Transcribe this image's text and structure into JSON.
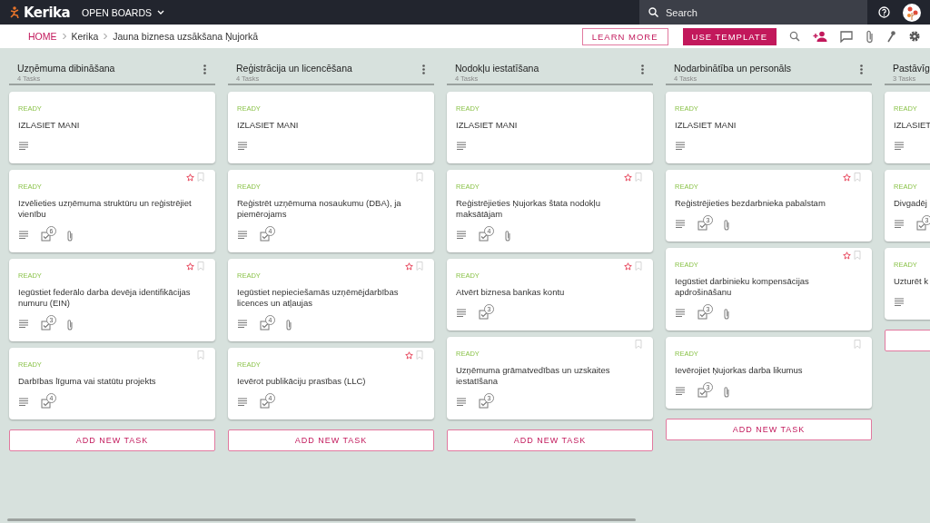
{
  "topbar": {
    "logo": "Kerika",
    "boards_menu": "OPEN BOARDS",
    "search": {
      "placeholder": "Search"
    }
  },
  "breadcrumb": [
    "HOME",
    "Kerika",
    "Jauna biznesa uzsākšana Ņujorkā"
  ],
  "actions": {
    "learn_more": "LEARN MORE",
    "use_template": "USE TEMPLATE"
  },
  "columns": [
    {
      "title": "Uzņēmuma dibināšana",
      "count": "4 Tasks",
      "add_task": "ADD NEW TASK",
      "cards": [
        {
          "status": "READY",
          "title": "IZLASIET MANI",
          "attachment": false,
          "starred": false,
          "bookmark": false
        },
        {
          "status": "READY",
          "title": "Izvēlieties uzņēmuma struktūru un reģistrējiet vienību",
          "checklist": "6",
          "attachment": true,
          "starred": true,
          "bookmark": true
        },
        {
          "status": "READY",
          "title": "Iegūstiet federālo darba devēja identifikācijas numuru (EIN)",
          "checklist": "3",
          "attachment": true,
          "starred": true,
          "bookmark": true
        },
        {
          "status": "READY",
          "title": "Darbības līguma vai statūtu projekts",
          "checklist": "4",
          "attachment": false,
          "starred": false,
          "bookmark": true
        }
      ]
    },
    {
      "title": "Reģistrācija un licencēšana",
      "count": "4 Tasks",
      "add_task": "ADD NEW TASK",
      "cards": [
        {
          "status": "READY",
          "title": "IZLASIET MANI",
          "attachment": false,
          "starred": false,
          "bookmark": false
        },
        {
          "status": "READY",
          "title": "Reģistrēt uzņēmuma nosaukumu (DBA), ja piemērojams",
          "checklist": "4",
          "attachment": false,
          "starred": false,
          "bookmark": true
        },
        {
          "status": "READY",
          "title": "Iegūstiet nepieciešamās uzņēmējdarbības licences un atļaujas",
          "checklist": "4",
          "attachment": true,
          "starred": true,
          "bookmark": true
        },
        {
          "status": "READY",
          "title": "Ievērot publikāciju prasības (LLC)",
          "checklist": "4",
          "attachment": false,
          "starred": true,
          "bookmark": true
        }
      ]
    },
    {
      "title": "Nodokļu iestatīšana",
      "count": "4 Tasks",
      "add_task": "ADD NEW TASK",
      "cards": [
        {
          "status": "READY",
          "title": "IZLASIET MANI",
          "attachment": false,
          "starred": false,
          "bookmark": false
        },
        {
          "status": "READY",
          "title": "Reģistrējieties Ņujorkas štata nodokļu maksātājam",
          "checklist": "4",
          "attachment": true,
          "starred": true,
          "bookmark": true
        },
        {
          "status": "READY",
          "title": "Atvērt biznesa bankas kontu",
          "checklist": "3",
          "attachment": false,
          "starred": true,
          "bookmark": true
        },
        {
          "status": "READY",
          "title": "Uzņēmuma grāmatvedības un uzskaites iestatīšana",
          "checklist": "3",
          "attachment": false,
          "starred": false,
          "bookmark": true
        }
      ]
    },
    {
      "title": "Nodarbinātība un personāls",
      "count": "4 Tasks",
      "add_task": "ADD NEW TASK",
      "cards": [
        {
          "status": "READY",
          "title": "IZLASIET MANI",
          "attachment": false,
          "starred": false,
          "bookmark": false
        },
        {
          "status": "READY",
          "title": "Reģistrējieties bezdarbnieka pabalstam",
          "checklist": "3",
          "attachment": true,
          "starred": true,
          "bookmark": true
        },
        {
          "status": "READY",
          "title": "Iegūstiet darbinieku kompensācijas apdrošināšanu",
          "checklist": "3",
          "attachment": true,
          "starred": true,
          "bookmark": true
        },
        {
          "status": "READY",
          "title": "Ievērojiet Ņujorkas darba likumus",
          "checklist": "3",
          "attachment": true,
          "starred": false,
          "bookmark": true
        }
      ]
    },
    {
      "title": "Pastāvīg",
      "count": "3 Tasks",
      "cards": [
        {
          "status": "READY",
          "title": "IZLASIET",
          "attachment": false,
          "starred": false,
          "bookmark": false
        },
        {
          "status": "READY",
          "title": "Divgadēj",
          "checklist": "3",
          "attachment": false,
          "starred": false,
          "bookmark": false
        },
        {
          "status": "READY",
          "title": "Uzturēt k",
          "attachment": false,
          "starred": false,
          "bookmark": false
        }
      ]
    }
  ]
}
